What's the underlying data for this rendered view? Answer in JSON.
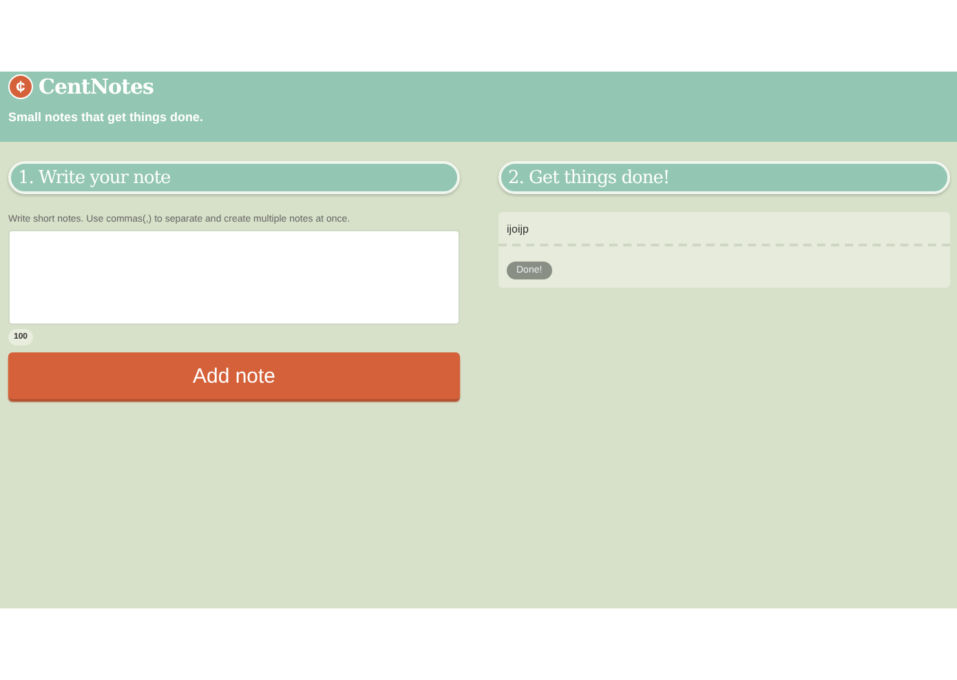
{
  "header": {
    "logo_mark": "¢",
    "title": "CentNotes",
    "tagline": "Small notes that get things done."
  },
  "write_panel": {
    "heading": "1. Write your note",
    "hint": "Write short notes. Use commas(,) to separate and create multiple notes at once.",
    "counter": "100",
    "button": "Add note"
  },
  "done_panel": {
    "heading": "2. Get things done!",
    "notes": [
      {
        "text": "ijoijp",
        "button": "Done!"
      }
    ]
  }
}
